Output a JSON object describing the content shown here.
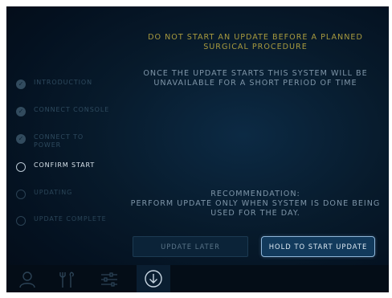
{
  "sidebar": {
    "steps": [
      {
        "label": "INTRODUCTION",
        "state": "done"
      },
      {
        "label": "CONNECT CONSOLE",
        "state": "done"
      },
      {
        "label": "CONNECT TO POWER",
        "state": "done"
      },
      {
        "label": "CONFIRM START",
        "state": "current"
      },
      {
        "label": "UPDATING",
        "state": "todo"
      },
      {
        "label": "UPDATE COMPLETE",
        "state": "todo"
      }
    ],
    "check_glyph": "✓"
  },
  "main": {
    "warning": "DO NOT START AN UPDATE BEFORE A PLANNED SURGICAL PROCEDURE",
    "info": "ONCE THE UPDATE STARTS THIS SYSTEM WILL BE UNAVAILABLE FOR A SHORT PERIOD OF TIME",
    "recommendation_title": "RECOMMENDATION:",
    "recommendation_text": "PERFORM UPDATE ONLY WHEN SYSTEM IS DONE BEING USED FOR THE DAY."
  },
  "buttons": {
    "later": "UPDATE LATER",
    "start": "HOLD TO START UPDATE"
  },
  "toolbar": {
    "icons": [
      "user-icon",
      "tools-icon",
      "sliders-icon",
      "download-icon"
    ],
    "active": "download-icon"
  },
  "colors": {
    "warning": "#a89a3e",
    "accent": "#8fb6d8",
    "background": "#071a2b"
  }
}
